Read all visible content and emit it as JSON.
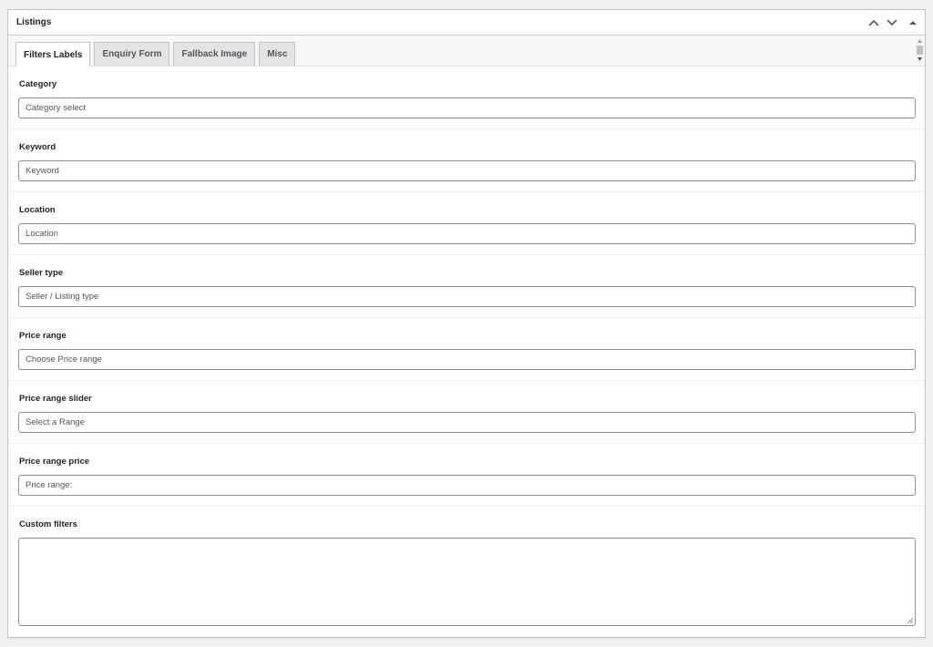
{
  "panel": {
    "title": "Listings",
    "controls": {
      "move_up_icon": "chevron-up-icon",
      "move_down_icon": "chevron-down-icon",
      "toggle_icon": "triangle-up-icon"
    }
  },
  "tabs": [
    {
      "label": "Filters Labels",
      "active": true
    },
    {
      "label": "Enquiry Form",
      "active": false
    },
    {
      "label": "Fallback Image",
      "active": false
    },
    {
      "label": "Misc",
      "active": false
    }
  ],
  "fields": [
    {
      "label": "Category",
      "value": "Category select"
    },
    {
      "label": "Keyword",
      "value": "Keyword"
    },
    {
      "label": "Location",
      "value": "Location"
    },
    {
      "label": "Seller type",
      "value": "Seller / Listing type"
    },
    {
      "label": "Price range",
      "value": "Choose Price range"
    },
    {
      "label": "Price range slider",
      "value": "Select a Range"
    },
    {
      "label": "Price range price",
      "value": "Price range:"
    },
    {
      "label": "Custom filters",
      "value": ""
    }
  ],
  "colors": {
    "page_bg": "#f0f0f1",
    "border": "#c3c4c7",
    "input_border": "#8c8f94",
    "text": "#1d2327",
    "muted_text": "#50575e"
  }
}
